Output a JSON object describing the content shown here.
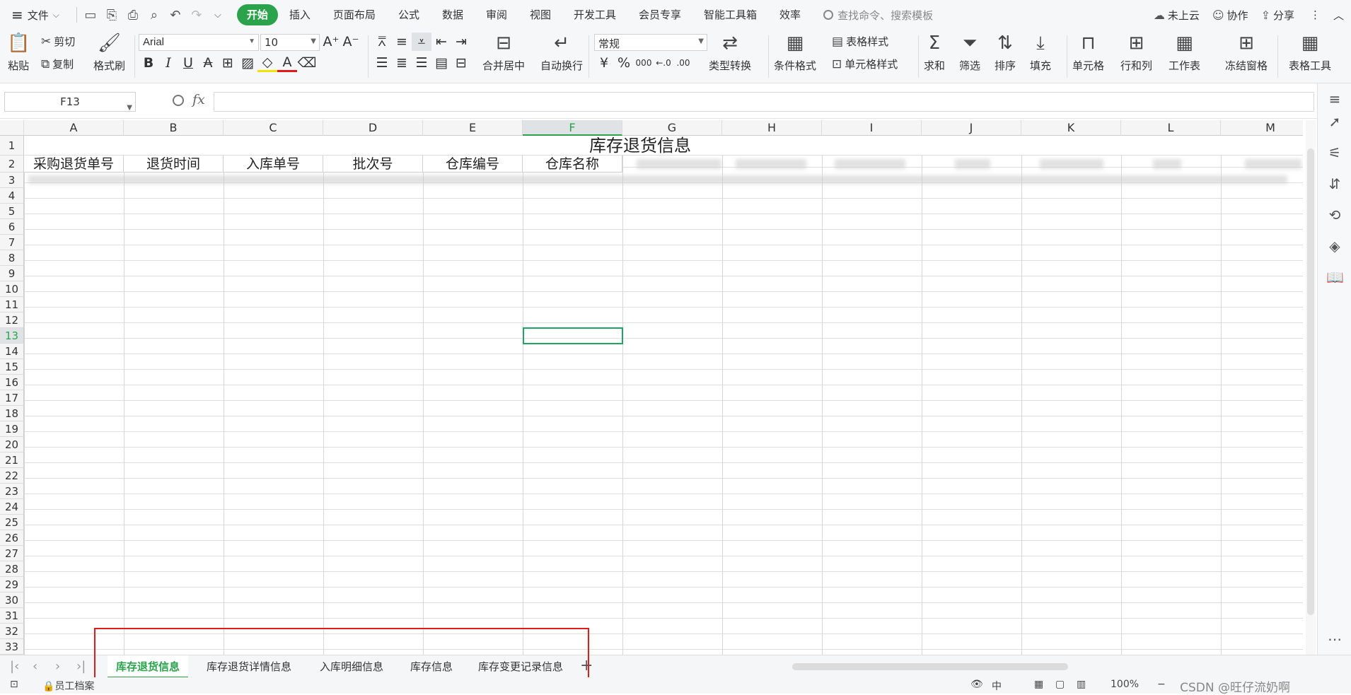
{
  "topbar": {
    "file_menu": "文件",
    "tabs": [
      "开始",
      "插入",
      "页面布局",
      "公式",
      "数据",
      "审阅",
      "视图",
      "开发工具",
      "会员专享",
      "智能工具箱",
      "效率"
    ],
    "search_placeholder": "查找命令、搜索模板",
    "cloud": "未上云",
    "collab": "协作",
    "share": "分享"
  },
  "ribbon": {
    "paste": "粘贴",
    "cut": "剪切",
    "copy": "复制",
    "format_painter": "格式刷",
    "font_name": "Arial",
    "font_size": "10",
    "merge_center": "合并居中",
    "wrap_text": "自动换行",
    "number_format": "常规",
    "type_convert": "类型转换",
    "cond_format": "条件格式",
    "table_style": "表格样式",
    "cell_style": "单元格样式",
    "sum": "求和",
    "filter": "筛选",
    "sort": "排序",
    "fill": "填充",
    "cell": "单元格",
    "rowcol": "行和列",
    "worksheet": "工作表",
    "freeze": "冻结窗格",
    "table_tools": "表格工具"
  },
  "formula_bar": {
    "name_box": "F13",
    "fx": "fx",
    "value": ""
  },
  "grid": {
    "columns": [
      "A",
      "B",
      "C",
      "D",
      "E",
      "F",
      "G",
      "H",
      "I",
      "J",
      "K",
      "L",
      "M"
    ],
    "active_column": "F",
    "active_row": "13",
    "rows": [
      "1",
      "2",
      "3",
      "4",
      "5",
      "6",
      "7",
      "8",
      "9",
      "10",
      "11",
      "12",
      "13",
      "14",
      "15",
      "16",
      "17",
      "18",
      "19",
      "20",
      "21",
      "22",
      "23",
      "24",
      "25",
      "26",
      "27",
      "28",
      "29",
      "30",
      "31",
      "32",
      "33"
    ],
    "title": "库存退货信息",
    "headers": [
      "采购退货单号",
      "退货时间",
      "入库单号",
      "批次号",
      "仓库编号",
      "仓库名称"
    ]
  },
  "sheets": {
    "tabs": [
      "库存退货信息",
      "库存退货详情信息",
      "入库明细信息",
      "库存信息",
      "库存变更记录信息"
    ],
    "active": "库存退货信息",
    "add": "+"
  },
  "status": {
    "workbook": "员工档案",
    "view_mode": "中",
    "zoom": "100%",
    "watermark": "CSDN @旺仔流奶啊"
  },
  "colors": {
    "accent": "#2ba24c",
    "highlight_box": "#e11b1b"
  }
}
